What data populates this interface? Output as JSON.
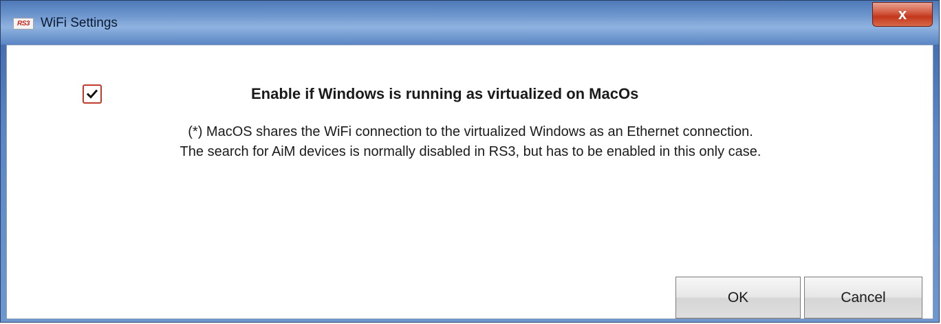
{
  "window": {
    "title": "WiFi Settings",
    "app_icon_text": "RS3",
    "close_label": "x"
  },
  "option": {
    "checked": true,
    "label": "Enable if Windows is running as virtualized on MacOs"
  },
  "description": {
    "line1": "(*) MacOS shares the WiFi connection to the virtualized Windows as an Ethernet connection.",
    "line2": "The search for AiM devices is normally disabled in RS3, but has to be enabled in this only case."
  },
  "buttons": {
    "ok_label": "OK",
    "cancel_label": "Cancel"
  },
  "colors": {
    "checkbox_border": "#c0392b",
    "close_button": "#c3371d"
  }
}
